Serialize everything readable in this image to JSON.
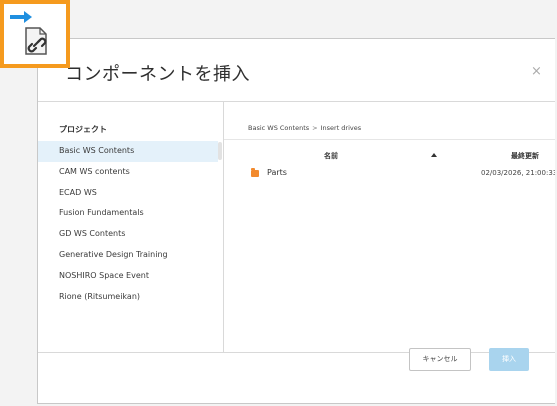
{
  "dialog": {
    "title": "コンポーネントを挿入",
    "close_symbol": "×"
  },
  "sidebar": {
    "header": "プロジェクト",
    "items": [
      {
        "label": "Basic WS Contents",
        "selected": true
      },
      {
        "label": "CAM WS contents"
      },
      {
        "label": "ECAD WS"
      },
      {
        "label": "Fusion Fundamentals"
      },
      {
        "label": "GD WS Contents"
      },
      {
        "label": "Generative Design Training"
      },
      {
        "label": "NOSHIRO Space Event"
      },
      {
        "label": "Rione (Ritsumeikan)"
      }
    ]
  },
  "breadcrumb": {
    "items": [
      "Basic WS Contents",
      "Insert drives"
    ],
    "separator": ">"
  },
  "table": {
    "columns": {
      "name": "名前",
      "modified": "最終更新"
    },
    "sort": "ascending",
    "rows": [
      {
        "icon": "folder-icon",
        "name": "Parts",
        "modified": "02/03/2026, 21:00:33"
      }
    ]
  },
  "buttons": {
    "cancel": "キャンセル",
    "insert": "挿入"
  },
  "colors": {
    "accent_orange": "#f59a1e",
    "selection": "#e4f1fa",
    "insert_disabled": "#a9d4ee",
    "arrow_blue": "#1f8fe0",
    "folder": "#f28a2e"
  }
}
